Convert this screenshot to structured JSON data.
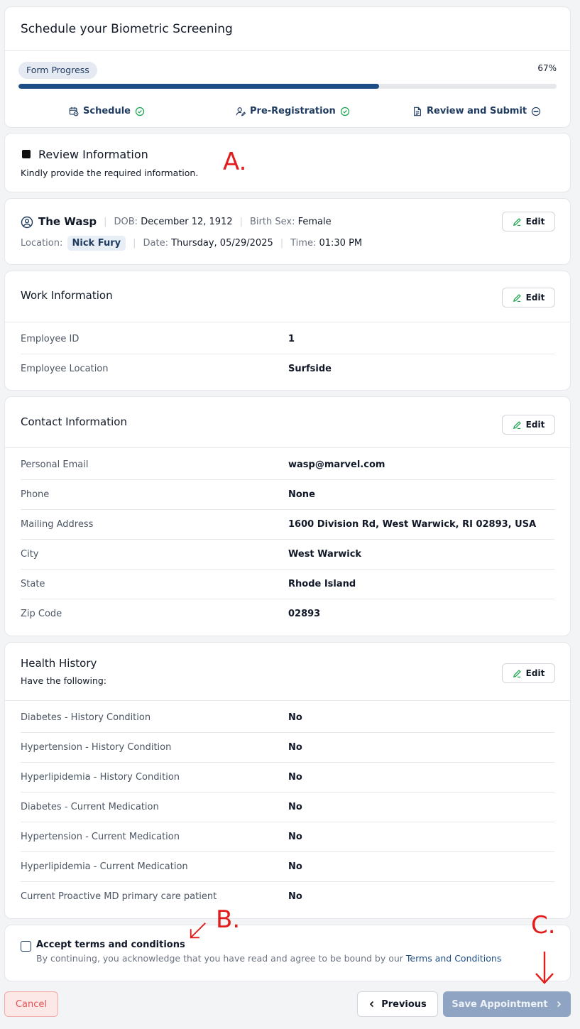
{
  "header": {
    "title": "Schedule your Biometric Screening",
    "progress_label": "Form Progress",
    "progress_percent": "67%",
    "progress_value": 0.67,
    "steps": [
      {
        "label": "Schedule",
        "status": "complete"
      },
      {
        "label": "Pre-Registration",
        "status": "complete"
      },
      {
        "label": "Review and Submit",
        "status": "in-progress"
      }
    ]
  },
  "review": {
    "title": "Review Information",
    "subtitle": "Kindly provide the required information."
  },
  "patient": {
    "name": "The Wasp",
    "dob_label": "DOB:",
    "dob": "December 12, 1912",
    "sex_label": "Birth Sex:",
    "sex": "Female",
    "location_label": "Location:",
    "location": "Nick Fury",
    "date_label": "Date:",
    "date": "Thursday, 05/29/2025",
    "time_label": "Time:",
    "time": "01:30 PM",
    "edit_label": "Edit"
  },
  "work": {
    "title": "Work Information",
    "edit_label": "Edit",
    "rows": [
      {
        "label": "Employee ID",
        "value": "1"
      },
      {
        "label": "Employee Location",
        "value": "Surfside"
      }
    ]
  },
  "contact": {
    "title": "Contact Information",
    "edit_label": "Edit",
    "rows": [
      {
        "label": "Personal Email",
        "value": "wasp@marvel.com"
      },
      {
        "label": "Phone",
        "value": "None"
      },
      {
        "label": "Mailing Address",
        "value": "1600 Division Rd, West Warwick, RI 02893, USA"
      },
      {
        "label": "City",
        "value": "West Warwick"
      },
      {
        "label": "State",
        "value": "Rhode Island"
      },
      {
        "label": "Zip Code",
        "value": "02893"
      }
    ]
  },
  "health": {
    "title": "Health History",
    "subtitle": "Have the following:",
    "edit_label": "Edit",
    "rows": [
      {
        "label": "Diabetes - History Condition",
        "value": "No"
      },
      {
        "label": "Hypertension - History Condition",
        "value": "No"
      },
      {
        "label": "Hyperlipidemia - History Condition",
        "value": "No"
      },
      {
        "label": "Diabetes - Current Medication",
        "value": "No"
      },
      {
        "label": "Hypertension - Current Medication",
        "value": "No"
      },
      {
        "label": "Hyperlipidemia - Current Medication",
        "value": "No"
      },
      {
        "label": "Current Proactive MD primary care patient",
        "value": "No"
      }
    ]
  },
  "terms": {
    "label": "Accept terms and conditions",
    "text": "By continuing, you acknowledge that you have read and agree to be bound by our",
    "link": "Terms and Conditions"
  },
  "footer": {
    "cancel": "Cancel",
    "previous": "Previous",
    "save": "Save Appointment"
  },
  "annotations": {
    "a": "A.",
    "b": "B.",
    "c": "C."
  },
  "colors": {
    "primary": "#1e4d86",
    "check": "#16a34a",
    "cancel": "#e05252",
    "save_disabled": "#8ea4c2",
    "annotation": "#e11d1d"
  }
}
